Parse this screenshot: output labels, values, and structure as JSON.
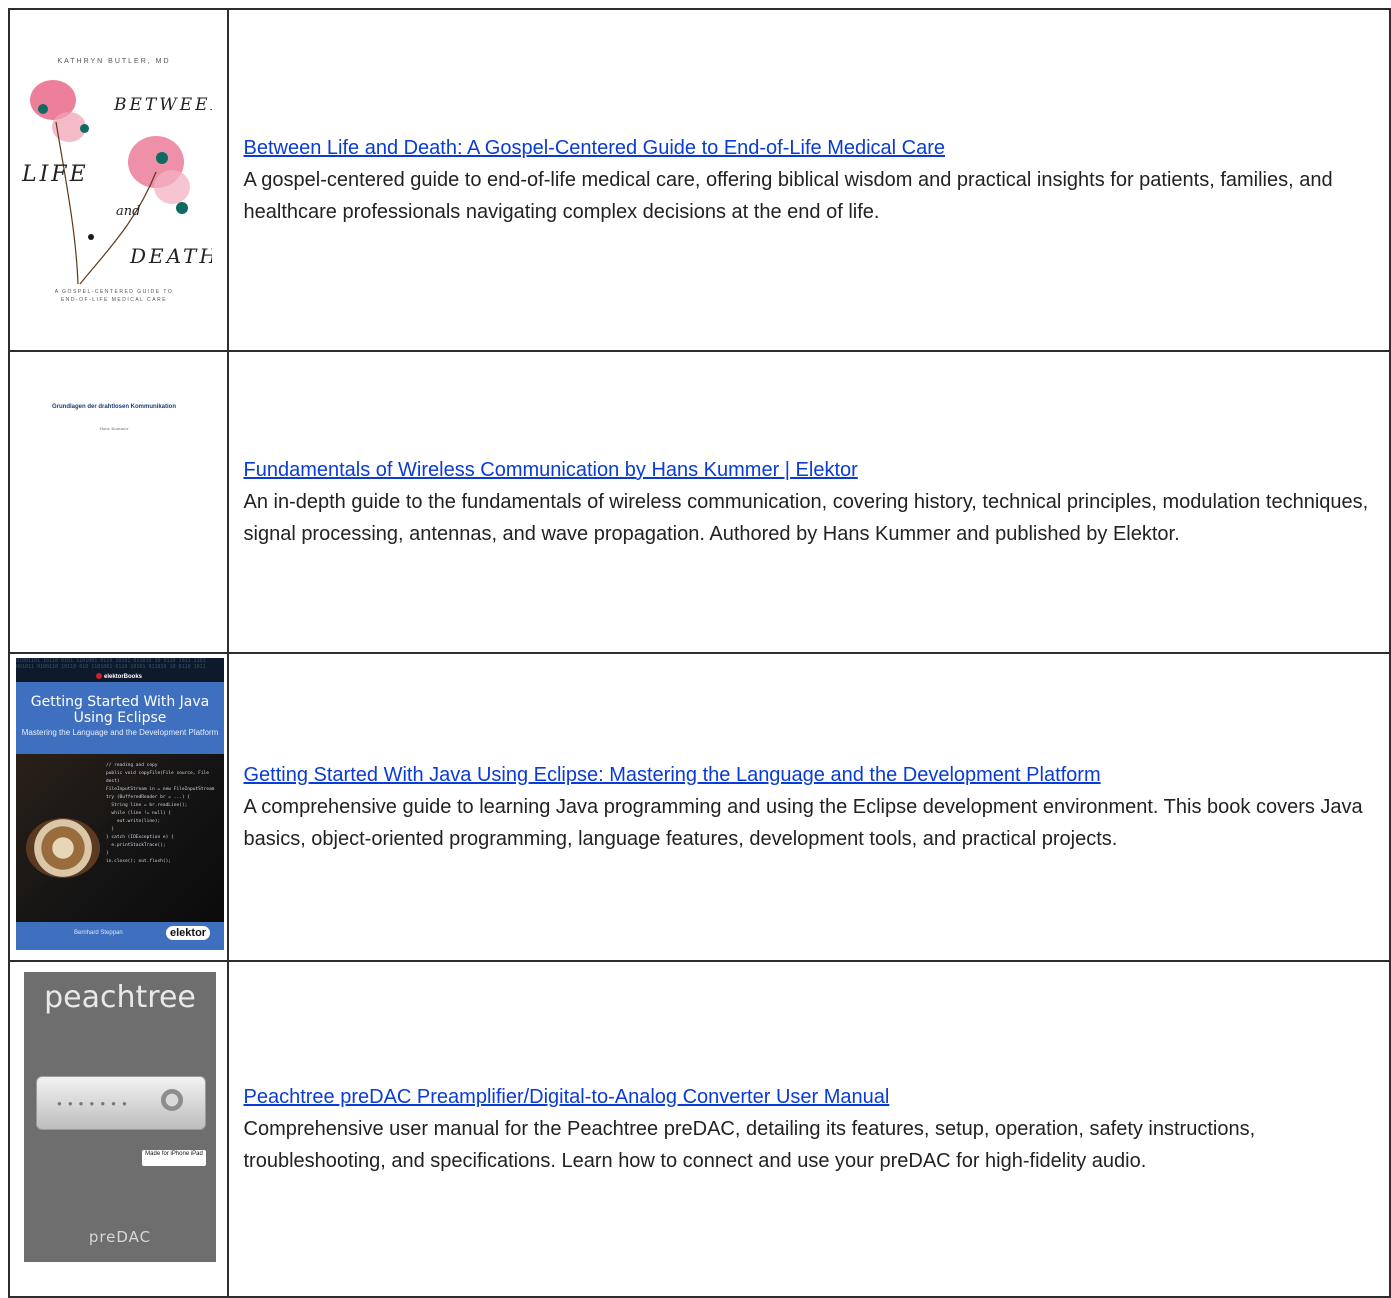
{
  "items": [
    {
      "title": "Between Life and Death: A Gospel-Centered Guide to End-of-Life Medical Care",
      "description": "A gospel-centered guide to end-of-life medical care, offering biblical wisdom and practical insights for patients, families, and healthcare professionals navigating complex decisions at the end of life.",
      "cover": {
        "author": "KATHRYN BUTLER, MD",
        "word1": "BETWEEN",
        "word2": "LIFE",
        "word3": "and",
        "word4": "DEATH",
        "subtitle_line1": "A GOSPEL-CENTERED GUIDE TO",
        "subtitle_line2": "END-OF-LIFE MEDICAL CARE"
      }
    },
    {
      "title": "Fundamentals of Wireless Communication by Hans Kummer | Elektor",
      "description": "An in-depth guide to the fundamentals of wireless communication, covering history, technical principles, modulation techniques, signal processing, antennas, and wave propagation. Authored by Hans Kummer and published by Elektor.",
      "cover": {
        "title": "Grundlagen der drahtlosen Kommunikation",
        "author": "Hans Kummer"
      }
    },
    {
      "title": "Getting Started With Java Using Eclipse: Mastering the Language and the Development Platform",
      "description": "A comprehensive guide to learning Java programming and using the Eclipse development environment. This book covers Java basics, object-oriented programming, language features, development tools, and practical projects.",
      "cover": {
        "brand": "elektorBooks",
        "title": "Getting Started With Java Using Eclipse",
        "subtitle": "Mastering the Language and the Development Platform",
        "author": "Bernhard Steppan",
        "logo": "elektor"
      }
    },
    {
      "title": "Peachtree preDAC Preamplifier/Digital-to-Analog Converter User Manual",
      "description": "Comprehensive user manual for the Peachtree preDAC, detailing its features, setup, operation, safety instructions, troubleshooting, and specifications. Learn how to connect and use your preDAC for high-fidelity audio.",
      "cover": {
        "brand": "peachtree",
        "badge": "Made for iPhone iPad",
        "model": "preDAC"
      }
    }
  ],
  "colors": {
    "link": "#0a3bd6",
    "text": "#222222",
    "border": "#2d2d2d"
  }
}
